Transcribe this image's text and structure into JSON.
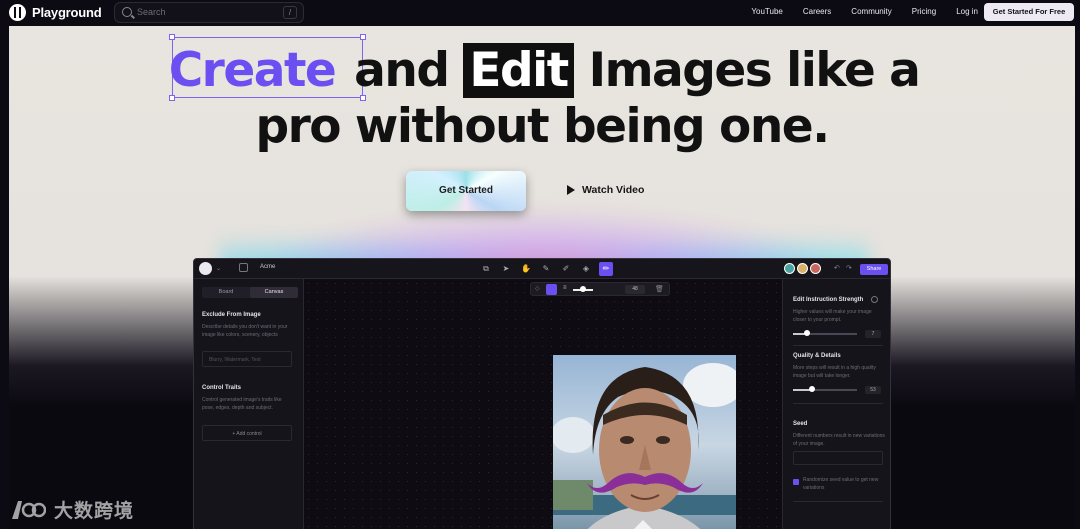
{
  "nav": {
    "brand": "Playground",
    "search_placeholder": "Search",
    "search_shortcut": "/",
    "links": [
      "YouTube",
      "Careers",
      "Community",
      "Pricing",
      "Log in"
    ],
    "cta": "Get Started For Free"
  },
  "hero": {
    "word_create": "Create",
    "word_and": "and",
    "word_edit": "Edit",
    "line1_rest": "Images like a",
    "line2": "pro without being one.",
    "get_started": "Get Started",
    "watch_video": "Watch Video"
  },
  "app": {
    "project_name": "Acme",
    "share": "Share",
    "left": {
      "tab_board": "Board",
      "tab_canvas": "Canvas",
      "exclude_title": "Exclude From Image",
      "exclude_desc": "Describe details you don't want in your image like colors, scenery, objects",
      "exclude_placeholder": "Blurry, Watermark, Text",
      "control_title": "Control Traits",
      "control_desc": "Control generated image's traits like pose, edges, depth and subject.",
      "add_control": "+ Add control"
    },
    "brush_value": "48",
    "right": {
      "edit_strength_title": "Edit Instruction Strength",
      "edit_strength_desc": "Higher values will make your image closer to your prompt.",
      "edit_strength_value": "7",
      "edit_strength_level": 0.22,
      "quality_title": "Quality & Details",
      "quality_desc": "More steps will result in a high quality image but will take longer.",
      "quality_value": "53",
      "quality_level": 0.3,
      "seed_title": "Seed",
      "seed_desc": "Different numbers result in new variations of your image.",
      "randomize_label": "Randomize seed value to get new variations"
    }
  },
  "watermark": "大数跨境",
  "colors": {
    "accent": "#6b4ff0",
    "hero_bg": "#e8e4df",
    "page_bg": "#0c0a12"
  }
}
